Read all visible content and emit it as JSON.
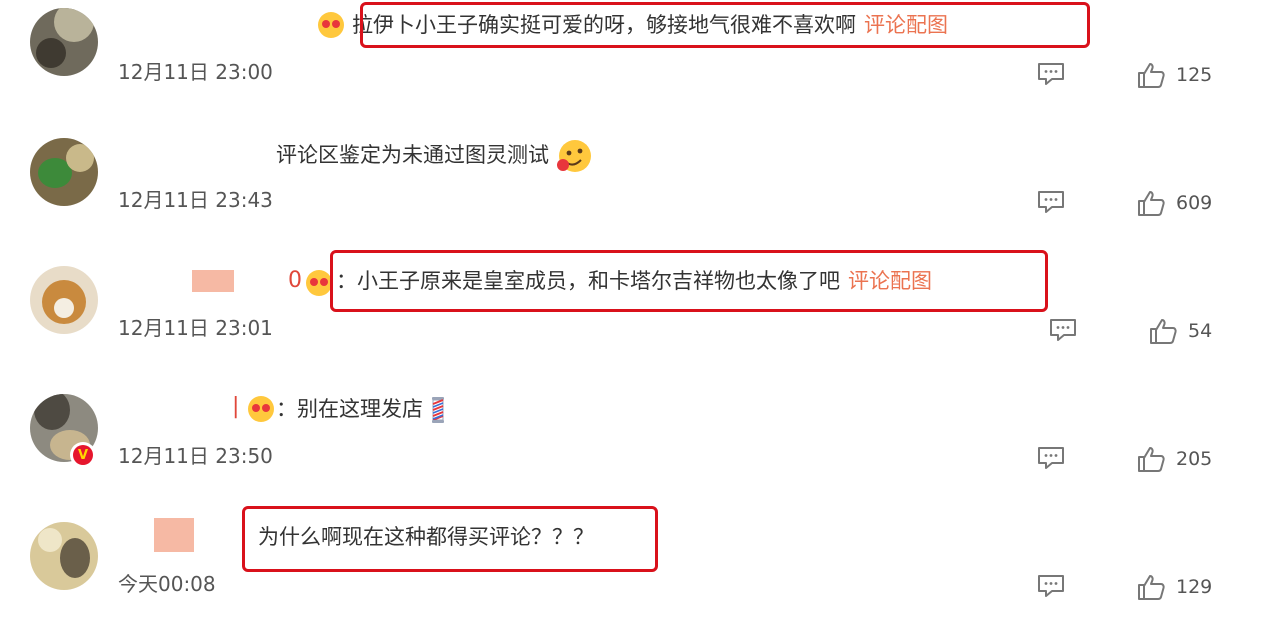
{
  "comments": [
    {
      "text": "拉伊卜小王子确实挺可爱的呀，够接地气很难不喜欢啊",
      "link": "评论配图",
      "time": "12月11日 23:00",
      "likes": "125"
    },
    {
      "text": "评论区鉴定为未通过图灵测试",
      "link": "",
      "time": "12月11日 23:43",
      "likes": "609"
    },
    {
      "text": "小王子原来是皇室成员，和卡塔尔吉祥物也太像了吧",
      "link": "评论配图",
      "time": "12月11日 23:01",
      "likes": "54"
    },
    {
      "text": "别在这理发店",
      "link": "",
      "time": "12月11日 23:50",
      "likes": "205"
    },
    {
      "text": "为什么啊现在这种都得买评论？？？",
      "link": "",
      "time": "今天00:08",
      "likes": "129"
    }
  ],
  "colors": {
    "highlight_box": "#d9111b",
    "link": "#eb7350",
    "verified_badge": "#e6162d"
  },
  "icons": {
    "reply": "comment-bubble-icon",
    "like": "thumbs-up-icon",
    "verified": "verified-v-badge-icon",
    "barber_pole": "barber-pole-emoji",
    "drooling_face": "drooling-face-emoji"
  }
}
